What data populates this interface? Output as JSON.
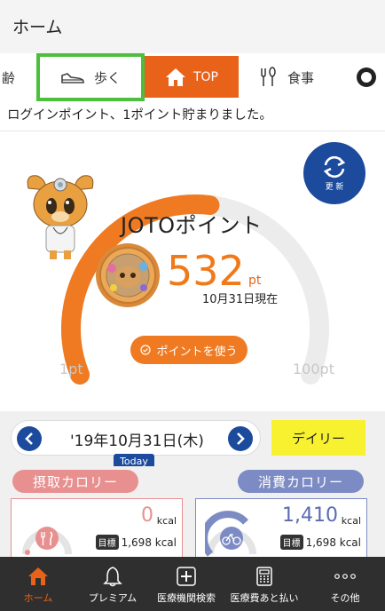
{
  "appbar": {
    "title": "ホーム"
  },
  "tabs": {
    "age_partial": "齢",
    "walk": {
      "label": "歩く",
      "icon": "shoe-icon"
    },
    "top": {
      "label": "TOP",
      "icon": "house-icon"
    },
    "food": {
      "label": "食事",
      "icon": "fork-spoon-icon"
    },
    "next_icon": "soccer-ball-icon"
  },
  "message": "ログインポイント、1ポイント貯まりました。",
  "points": {
    "refresh_label": "更 新",
    "title": "JOTOポイント",
    "value": "532",
    "unit": "pt",
    "as_of": "10月31日現在",
    "use_button": "ポイントを使う",
    "range_min": "1pt",
    "range_max": "100pt",
    "gauge_progress": 0.53,
    "accent_color": "#ef7a22"
  },
  "datebar": {
    "date": "'19年10月31日(木)",
    "today_label": "Today",
    "period_label": "デイリー"
  },
  "calories": {
    "intake": {
      "label": "摂取カロリー",
      "value": "0",
      "unit": "kcal",
      "goal_tag": "目標",
      "goal": "1,698 kcal"
    },
    "burned": {
      "label": "消費カロリー",
      "value": "1,410",
      "unit": "kcal",
      "goal_tag": "目標",
      "goal": "1,698 kcal"
    }
  },
  "bottom_nav": [
    {
      "label": "ホーム",
      "icon": "home-icon"
    },
    {
      "label": "プレミアム",
      "icon": "bell-icon"
    },
    {
      "label": "医療機関検索",
      "icon": "medical-cross-icon"
    },
    {
      "label": "医療費あと払い",
      "icon": "calculator-icon"
    },
    {
      "label": "その他",
      "icon": "more-dots-icon"
    }
  ]
}
